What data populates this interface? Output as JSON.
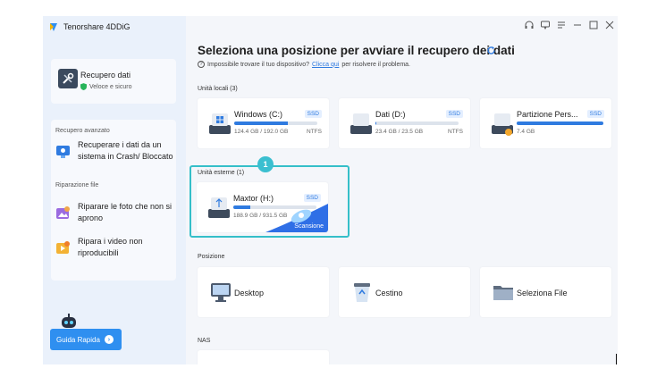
{
  "app": {
    "title": "Tenorshare 4DDiG"
  },
  "sidebar": {
    "data_recovery": {
      "title": "Recupero dati",
      "subtitle": "Veloce e sicuro"
    },
    "advanced": {
      "section_label": "Recupero avanzato",
      "crash_item": "Recuperare i dati da un sistema in Crash/ Bloccato",
      "repair_label": "Riparazione file",
      "photo_item": "Riparare le foto che non si aprono",
      "video_item": "Ripara i video non riproducibili"
    },
    "guide_button": "Guida Rapida"
  },
  "main": {
    "heading": "Seleziona una posizione per avviare il recupero dei dati",
    "help_prefix": "Impossibile trovare il tuo dispositivo?",
    "help_link": "Clicca qui",
    "help_suffix": "per risolvere il problema.",
    "local_section": "Unità locali (3)",
    "drives": [
      {
        "name": "Windows (C:)",
        "tag": "SSD",
        "size": "124.4 GB / 192.0 GB",
        "fs": "NTFS",
        "used_fraction": 0.65
      },
      {
        "name": "Dati (D:)",
        "tag": "SSD",
        "size": "23.4 GB / 23.5 GB",
        "fs": "NTFS",
        "used_fraction": 0.01
      },
      {
        "name": "Partizione Pers...",
        "tag": "SSD",
        "size": "7.4 GB",
        "fs": "",
        "used_fraction": 1.0
      }
    ],
    "step_badge": "1",
    "external_section": "Unità esterne (1)",
    "external_drive": {
      "name": "Maxtor (H:)",
      "tag": "SSD",
      "size": "188.9 GB / 931.5 GB",
      "scan_label": "Scansione",
      "used_fraction": 0.2
    },
    "location_section": "Posizione",
    "locations": [
      {
        "label": "Desktop",
        "icon": "monitor-icon"
      },
      {
        "label": "Cestino",
        "icon": "recycle-bin-icon"
      },
      {
        "label": "Seleziona File",
        "icon": "folder-icon"
      }
    ],
    "nas_section": "NAS"
  },
  "colors": {
    "accent": "#2f7be0",
    "highlight": "#35bfc9",
    "sidebar": "#eaf1fb"
  }
}
